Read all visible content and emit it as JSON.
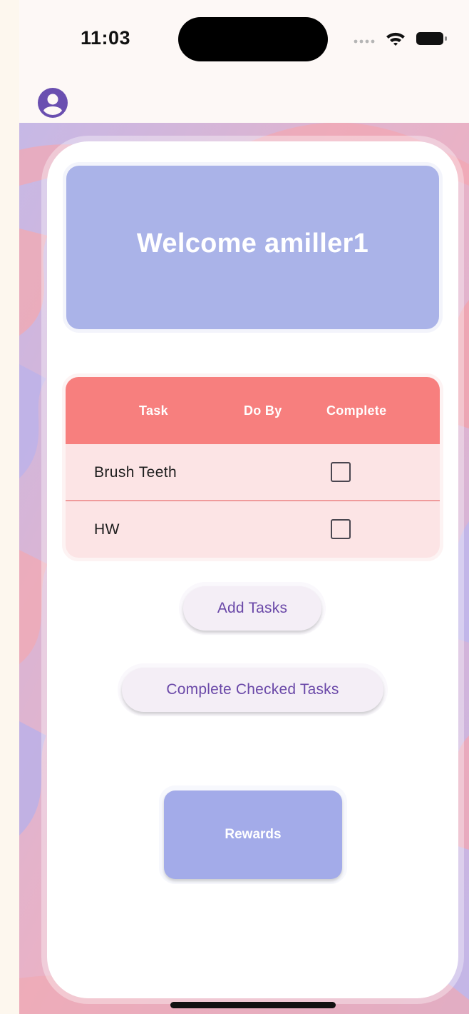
{
  "status_bar": {
    "time": "11:03"
  },
  "header": {
    "avatar_icon": "account-circle-icon"
  },
  "welcome": {
    "text": "Welcome amiller1"
  },
  "task_table": {
    "columns": [
      "Task",
      "Do By",
      "Complete"
    ],
    "rows": [
      {
        "task": "Brush Teeth",
        "do_by": "",
        "complete": false
      },
      {
        "task": "HW",
        "do_by": "",
        "complete": false
      }
    ]
  },
  "buttons": {
    "add_tasks": "Add Tasks",
    "complete_checked": "Complete Checked Tasks",
    "rewards": "Rewards"
  },
  "colors": {
    "welcome_bg": "#aab3e8",
    "table_header_bg": "#f77f7e",
    "table_row_bg": "#fce4e5",
    "button_text": "#6a48a8",
    "rewards_bg": "#a3abe9",
    "avatar": "#6a4fb0"
  }
}
